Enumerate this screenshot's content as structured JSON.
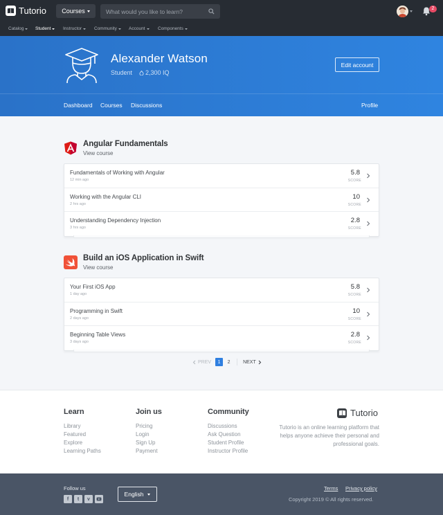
{
  "topbar": {
    "brand": "Tutorio",
    "courses_label": "Courses",
    "search_placeholder": "What would you like to learn?",
    "notification_count": "2"
  },
  "subnav": [
    "Catalog",
    "Student",
    "Instructor",
    "Community",
    "Account",
    "Components"
  ],
  "subnav_active": "Student",
  "profile": {
    "name": "Alexander Watson",
    "role": "Student",
    "iq": "2,300 IQ",
    "edit_label": "Edit account",
    "tabs": [
      "Dashboard",
      "Courses",
      "Discussions"
    ],
    "profile_tab": "Profile"
  },
  "courses": [
    {
      "title": "Angular Fundamentals",
      "link": "View course",
      "logo": "angular-logo",
      "lessons": [
        {
          "title": "Fundamentals of Working with Angular",
          "time": "12 min ago",
          "score": "5.8",
          "score_label": "SCORE"
        },
        {
          "title": "Working with the Angular CLI",
          "time": "2 hrs ago",
          "score": "10",
          "score_label": "SCORE"
        },
        {
          "title": "Understanding Dependency Injection",
          "time": "3 hrs ago",
          "score": "2.8",
          "score_label": "SCORE"
        }
      ]
    },
    {
      "title": "Build an iOS Application in Swift",
      "link": "View course",
      "logo": "swift-logo",
      "lessons": [
        {
          "title": "Your First iOS App",
          "time": "1 day ago",
          "score": "5.8",
          "score_label": "SCORE"
        },
        {
          "title": "Programming in Swift",
          "time": "2 days ago",
          "score": "10",
          "score_label": "SCORE"
        },
        {
          "title": "Beginning Table Views",
          "time": "3 days ago",
          "score": "2.8",
          "score_label": "SCORE"
        }
      ]
    }
  ],
  "pagination": {
    "prev": "PREV",
    "pages": [
      "1",
      "2"
    ],
    "current": "1",
    "next": "NEXT"
  },
  "footer": {
    "columns": [
      {
        "title": "Learn",
        "links": [
          "Library",
          "Featured",
          "Explore",
          "Learning Paths"
        ]
      },
      {
        "title": "Join us",
        "links": [
          "Pricing",
          "Login",
          "Sign Up",
          "Payment"
        ]
      },
      {
        "title": "Community",
        "links": [
          "Discussions",
          "Ask Question",
          "Student Profile",
          "Instructor Profile"
        ]
      }
    ],
    "brand": "Tutorio",
    "description": "Tutorio is an online learning platform that helps anyone achieve their personal and professional goals.",
    "follow_us": "Follow us",
    "language": "English",
    "terms": "Terms",
    "privacy": "Privacy policy",
    "copyright": "Copyright 2019 © All rights reserved."
  },
  "colors": {
    "accent": "#2f7fe0",
    "topbar": "#272c33",
    "footer_bar": "#4a5566",
    "badge": "#e74a65"
  }
}
